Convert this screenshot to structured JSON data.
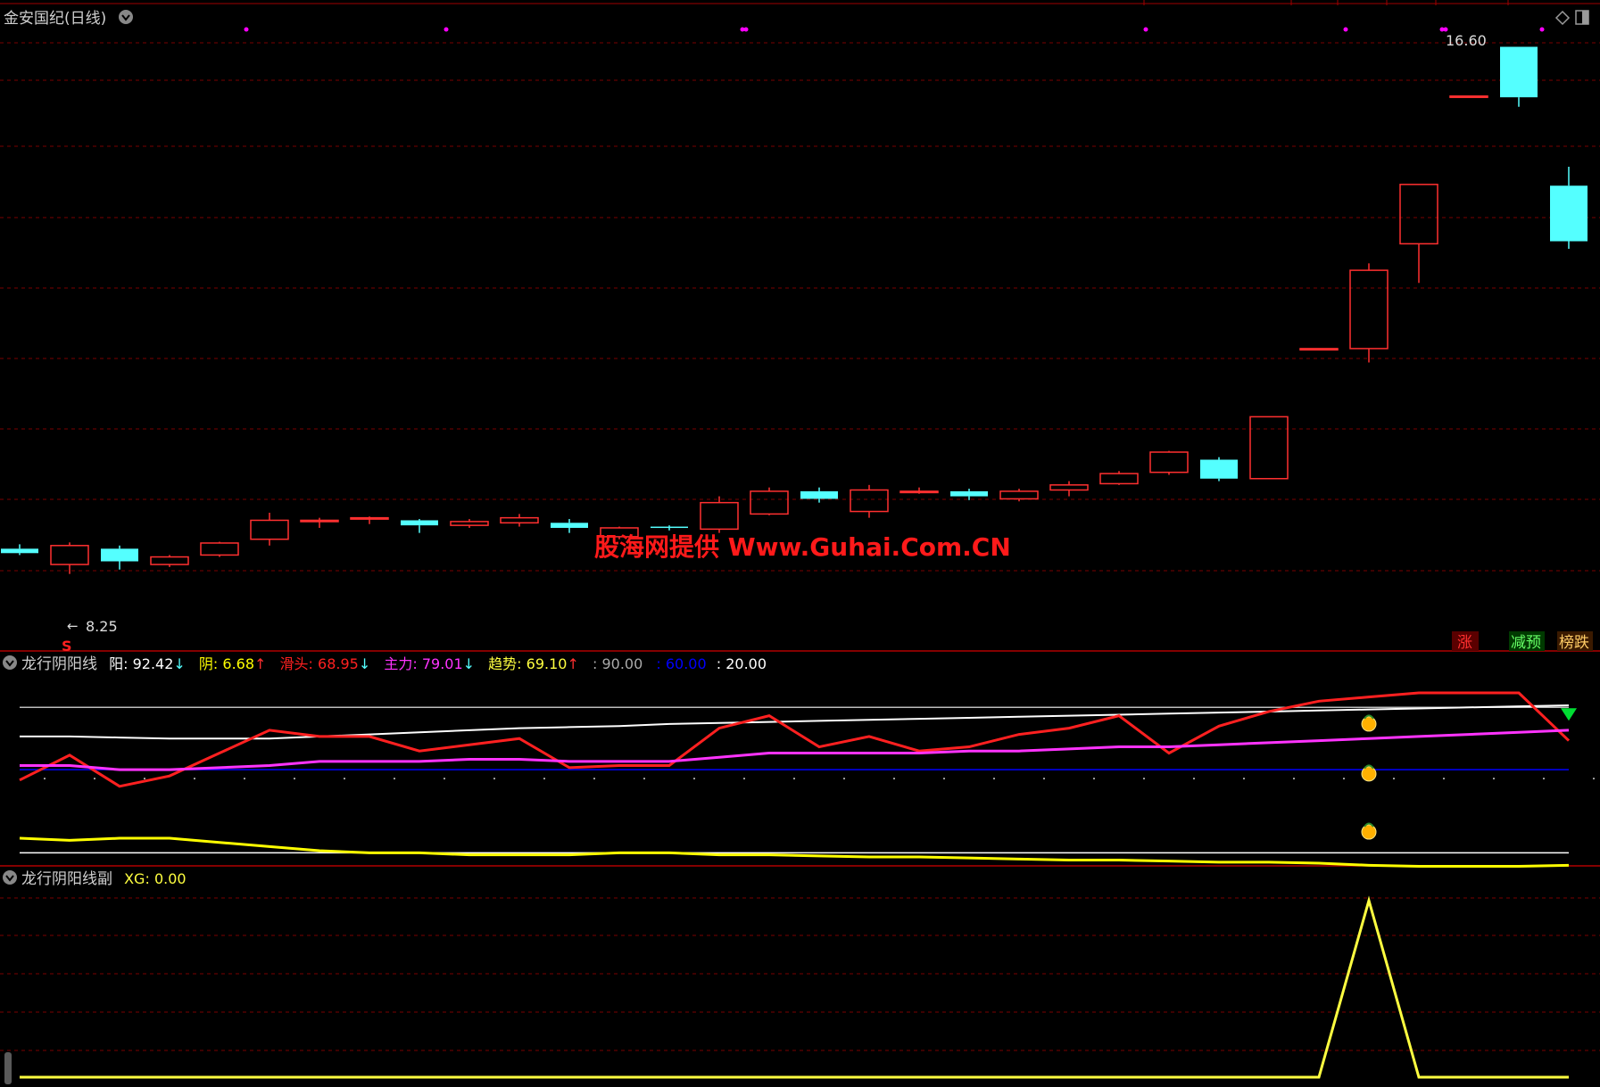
{
  "window": {
    "title": "金安国纪(日线)",
    "watermark": "股海网提供 Www.Guhai.Com.CN"
  },
  "colors": {
    "up": "#ff3030",
    "down": "#54ffff",
    "grid": "#7a0000",
    "purple_dot": "#ff00ff",
    "yang": "#ffffff",
    "yin": "#ffff00",
    "tou": "#ff2020",
    "zhuli": "#ff33ff",
    "qushi": "#ffff40",
    "ref60": "#0000ff"
  },
  "price_panel": {
    "max_label": "16.60",
    "min_label": "8.25",
    "signal_mark": "S",
    "tags": [
      {
        "text": "涨",
        "color": "#ff3030",
        "bg": "#5a0000"
      },
      {
        "text": "减预",
        "color": "#66ff66",
        "bg": "#003a00"
      },
      {
        "text": "榜跌",
        "color": "#ffcc66",
        "bg": "#3a1a00"
      }
    ]
  },
  "indicator1": {
    "name": "龙行阴阳线",
    "items": [
      {
        "key": "阳",
        "value": "92.42",
        "arrow": "↓",
        "color": "#ffffff",
        "arrow_color": "#54ffff"
      },
      {
        "key": "阴",
        "value": "6.68",
        "arrow": "↑",
        "color": "#ffff00",
        "arrow_color": "#ff3030"
      },
      {
        "key": "滑头",
        "value": "68.95",
        "arrow": "↓",
        "color": "#ff2020",
        "arrow_color": "#54ffff"
      },
      {
        "key": "主力",
        "value": "79.01",
        "arrow": "↓",
        "color": "#ff33ff",
        "arrow_color": "#54ffff"
      },
      {
        "key": "趋势",
        "value": "69.10",
        "arrow": "↑",
        "color": "#ffff40",
        "arrow_color": "#ff3030"
      },
      {
        "key": "",
        "value": "90.00",
        "arrow": "",
        "color": "#aaaaaa",
        "arrow_color": ""
      },
      {
        "key": "",
        "value": "60.00",
        "arrow": "",
        "color": "#0000ff",
        "arrow_color": ""
      },
      {
        "key": "",
        "value": "20.00",
        "arrow": "",
        "color": "#ffffff",
        "arrow_color": ""
      }
    ]
  },
  "indicator2": {
    "name": "龙行阴阳线副",
    "items": [
      {
        "key": "XG",
        "value": "0.00",
        "color": "#ffff40"
      }
    ]
  },
  "chart_data": [
    {
      "type": "candlestick",
      "title": "金安国纪(日线)",
      "y_range": [
        7.2,
        17.2
      ],
      "candles": [
        {
          "o": 8.65,
          "h": 8.72,
          "l": 8.55,
          "c": 8.58
        },
        {
          "o": 8.4,
          "h": 8.75,
          "l": 8.25,
          "c": 8.7
        },
        {
          "o": 8.65,
          "h": 8.7,
          "l": 8.32,
          "c": 8.45
        },
        {
          "o": 8.4,
          "h": 8.55,
          "l": 8.36,
          "c": 8.52
        },
        {
          "o": 8.55,
          "h": 8.76,
          "l": 8.52,
          "c": 8.74
        },
        {
          "o": 8.8,
          "h": 9.22,
          "l": 8.7,
          "c": 9.1
        },
        {
          "o": 9.08,
          "h": 9.14,
          "l": 8.98,
          "c": 9.1
        },
        {
          "o": 9.12,
          "h": 9.16,
          "l": 9.04,
          "c": 9.14
        },
        {
          "o": 9.1,
          "h": 9.12,
          "l": 8.9,
          "c": 9.02
        },
        {
          "o": 9.02,
          "h": 9.12,
          "l": 8.98,
          "c": 9.08
        },
        {
          "o": 9.06,
          "h": 9.2,
          "l": 9.0,
          "c": 9.14
        },
        {
          "o": 9.06,
          "h": 9.12,
          "l": 8.9,
          "c": 8.98
        },
        {
          "o": 8.84,
          "h": 9.0,
          "l": 8.8,
          "c": 8.98
        },
        {
          "o": 9.0,
          "h": 9.02,
          "l": 8.94,
          "c": 8.98
        },
        {
          "o": 8.96,
          "h": 9.48,
          "l": 8.9,
          "c": 9.38
        },
        {
          "o": 9.2,
          "h": 9.62,
          "l": 9.18,
          "c": 9.56
        },
        {
          "o": 9.56,
          "h": 9.62,
          "l": 9.38,
          "c": 9.44
        },
        {
          "o": 9.24,
          "h": 9.66,
          "l": 9.14,
          "c": 9.58
        },
        {
          "o": 9.56,
          "h": 9.62,
          "l": 9.52,
          "c": 9.56
        },
        {
          "o": 9.56,
          "h": 9.6,
          "l": 9.42,
          "c": 9.48
        },
        {
          "o": 9.44,
          "h": 9.6,
          "l": 9.4,
          "c": 9.56
        },
        {
          "o": 9.58,
          "h": 9.72,
          "l": 9.48,
          "c": 9.66
        },
        {
          "o": 9.68,
          "h": 9.88,
          "l": 9.66,
          "c": 9.84
        },
        {
          "o": 9.86,
          "h": 10.2,
          "l": 9.82,
          "c": 10.18
        },
        {
          "o": 10.06,
          "h": 10.1,
          "l": 9.72,
          "c": 9.76
        },
        {
          "o": 9.76,
          "h": 10.74,
          "l": 9.76,
          "c": 10.74
        },
        {
          "o": 11.82,
          "h": 11.82,
          "l": 11.82,
          "c": 11.82
        },
        {
          "o": 11.82,
          "h": 13.17,
          "l": 11.6,
          "c": 13.06
        },
        {
          "o": 13.48,
          "h": 14.42,
          "l": 12.86,
          "c": 14.42
        },
        {
          "o": 15.82,
          "h": 15.82,
          "l": 15.82,
          "c": 15.82
        },
        {
          "o": 16.6,
          "h": 16.6,
          "l": 15.65,
          "c": 15.8
        },
        {
          "o": 14.4,
          "h": 14.7,
          "l": 13.4,
          "c": 13.52
        }
      ],
      "purple_dot_indices": [
        5,
        9,
        14,
        15,
        23,
        27,
        28,
        29,
        30
      ],
      "max_label": "16.60",
      "min_label": "8.25"
    },
    {
      "type": "line",
      "title": "龙行阴阳线",
      "y_range": [
        15,
        100
      ],
      "reference_lines": [
        90,
        60,
        20
      ],
      "series": [
        {
          "name": "阳",
          "color": "#ffffff",
          "values": [
            76,
            76,
            75.5,
            75,
            75,
            75,
            76,
            77,
            78,
            79,
            80,
            80.5,
            81,
            82,
            82.5,
            83,
            83.5,
            84,
            84.5,
            85,
            85.5,
            86,
            86.5,
            87,
            87.5,
            88,
            88.5,
            89,
            89.5,
            90,
            90.5,
            91
          ]
        },
        {
          "name": "阴",
          "color": "#ffff00",
          "values": [
            27,
            26,
            27,
            27,
            25,
            23,
            21,
            20,
            20,
            19,
            19,
            19,
            20,
            20,
            19,
            19,
            18.5,
            18,
            18,
            17.5,
            17,
            16.5,
            16.5,
            16,
            15.5,
            15.5,
            15,
            14,
            13.5,
            13.5,
            13.5,
            14
          ]
        },
        {
          "name": "滑头",
          "color": "#ff2020",
          "values": [
            55,
            67,
            52,
            57,
            68,
            79,
            76,
            76,
            69,
            72,
            75,
            61,
            62,
            62,
            80,
            86,
            71,
            76,
            69,
            71,
            77,
            80,
            86,
            68,
            81,
            88,
            93,
            95,
            97,
            97,
            97,
            74
          ]
        },
        {
          "name": "主力",
          "color": "#ff33ff",
          "values": [
            62,
            62,
            60,
            60,
            61,
            62,
            64,
            64,
            64,
            65,
            65,
            64,
            64,
            64,
            66,
            68,
            68,
            68,
            68,
            69,
            69,
            70,
            71,
            71,
            72,
            73,
            74,
            75,
            76,
            77,
            78,
            79
          ]
        },
        {
          "name": "趋势",
          "color": "#ffff40",
          "values": [
            null,
            null,
            null,
            null,
            null,
            null,
            null,
            null,
            null,
            null,
            null,
            null,
            null,
            null,
            null,
            null,
            null,
            null,
            null,
            null,
            null,
            null,
            null,
            null,
            null,
            null,
            null,
            null,
            null,
            null,
            null,
            null
          ]
        }
      ],
      "coin_marks": {
        "index": 27,
        "values": [
          82,
          58,
          30
        ]
      },
      "triangle_mark": {
        "index": 31,
        "value": 87
      }
    },
    {
      "type": "line",
      "title": "龙行阴阳线副",
      "y_range": [
        0,
        1.05
      ],
      "series": [
        {
          "name": "XG",
          "color": "#ffff40",
          "values": [
            0,
            0,
            0,
            0,
            0,
            0,
            0,
            0,
            0,
            0,
            0,
            0,
            0,
            0,
            0,
            0,
            0,
            0,
            0,
            0,
            0,
            0,
            0,
            0,
            0,
            0,
            0,
            1,
            0,
            0,
            0,
            0
          ]
        }
      ]
    }
  ]
}
